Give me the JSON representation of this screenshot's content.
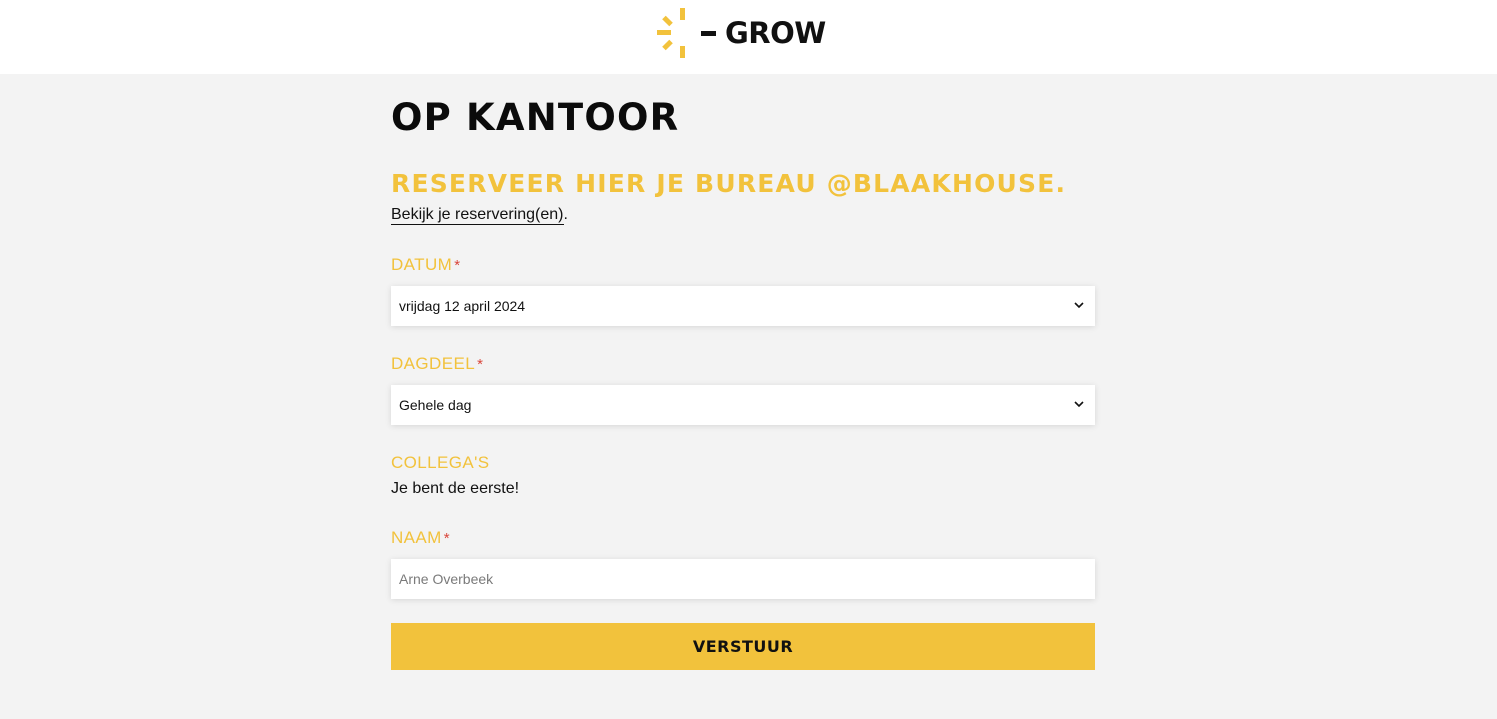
{
  "header": {
    "logo_text": "GROW",
    "brand_color": "#f2c23c"
  },
  "page": {
    "title": "OP KANTOOR",
    "subtitle": "RESERVEER HIER JE BUREAU @BLAAKHOUSE.",
    "view_link": "Bekijk je reservering(en)",
    "view_link_suffix": "."
  },
  "form": {
    "required_mark": "*",
    "date": {
      "label": "DATUM",
      "value": "vrijdag 12 april 2024",
      "icon": "chevron-down-icon"
    },
    "day_part": {
      "label": "DAGDEEL",
      "value": "Gehele dag",
      "icon": "chevron-down-icon"
    },
    "colleagues": {
      "label": "COLLEGA'S",
      "text": "Je bent de eerste!"
    },
    "name": {
      "label": "NAAM",
      "placeholder": "Arne Overbeek"
    },
    "submit_label": "VERSTUUR"
  }
}
